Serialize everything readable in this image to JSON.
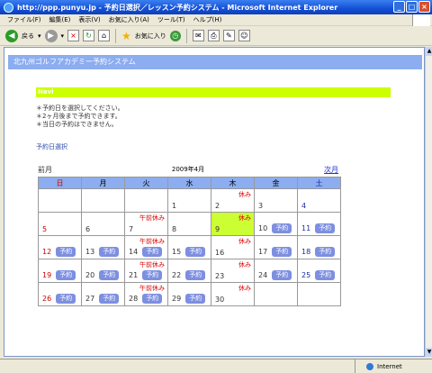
{
  "window": {
    "title": "http://ppp.punyu.jp - 予約日選択／レッスン予約システム - Microsoft Internet Explorer"
  },
  "menu": {
    "items": [
      "ファイル(F)",
      "編集(E)",
      "表示(V)",
      "お気に入り(A)",
      "ツール(T)",
      "ヘルプ(H)"
    ]
  },
  "toolbar": {
    "back_label": "戻る",
    "favorites_label": "お気に入り"
  },
  "status": {
    "zone_label": "Internet"
  },
  "page": {
    "header": "北九州ゴルフアカデミー予約システム",
    "navi": "Navi",
    "notes": [
      "＊予約日を選択してください。",
      "＊2ヶ月後まで予約できます。",
      "＊当日の予約はできません。"
    ],
    "section_link": "予約日選択"
  },
  "calendar": {
    "prev_label": "前月",
    "month_label": "2009年4月",
    "next_label": "次月",
    "reserve_label": "予約",
    "weekdays": [
      "日",
      "月",
      "火",
      "水",
      "木",
      "金",
      "土"
    ],
    "weeks": [
      [
        {
          "day": "",
          "note": "",
          "reserve": false
        },
        {
          "day": "",
          "note": "",
          "reserve": false
        },
        {
          "day": "",
          "note": "",
          "reserve": false
        },
        {
          "day": "1",
          "note": "",
          "reserve": false
        },
        {
          "day": "2",
          "note": "休み",
          "reserve": false
        },
        {
          "day": "3",
          "note": "",
          "reserve": false
        },
        {
          "day": "4",
          "note": "",
          "reserve": false
        }
      ],
      [
        {
          "day": "5",
          "note": "",
          "reserve": false
        },
        {
          "day": "6",
          "note": "",
          "reserve": false
        },
        {
          "day": "7",
          "note": "午前休み",
          "reserve": false
        },
        {
          "day": "8",
          "note": "",
          "reserve": false
        },
        {
          "day": "9",
          "note": "休み",
          "reserve": false,
          "today": true
        },
        {
          "day": "10",
          "note": "",
          "reserve": true
        },
        {
          "day": "11",
          "note": "",
          "reserve": true
        }
      ],
      [
        {
          "day": "12",
          "note": "",
          "reserve": true
        },
        {
          "day": "13",
          "note": "",
          "reserve": true
        },
        {
          "day": "14",
          "note": "午前休み",
          "reserve": true
        },
        {
          "day": "15",
          "note": "",
          "reserve": true
        },
        {
          "day": "16",
          "note": "休み",
          "reserve": false
        },
        {
          "day": "17",
          "note": "",
          "reserve": true
        },
        {
          "day": "18",
          "note": "",
          "reserve": true
        }
      ],
      [
        {
          "day": "19",
          "note": "",
          "reserve": true
        },
        {
          "day": "20",
          "note": "",
          "reserve": true
        },
        {
          "day": "21",
          "note": "午前休み",
          "reserve": true
        },
        {
          "day": "22",
          "note": "",
          "reserve": true
        },
        {
          "day": "23",
          "note": "休み",
          "reserve": false
        },
        {
          "day": "24",
          "note": "",
          "reserve": true
        },
        {
          "day": "25",
          "note": "",
          "reserve": true
        }
      ],
      [
        {
          "day": "26",
          "note": "",
          "reserve": true
        },
        {
          "day": "27",
          "note": "",
          "reserve": true
        },
        {
          "day": "28",
          "note": "午前休み",
          "reserve": true
        },
        {
          "day": "29",
          "note": "",
          "reserve": true
        },
        {
          "day": "30",
          "note": "休み",
          "reserve": false
        },
        {
          "day": "",
          "note": "",
          "reserve": false
        },
        {
          "day": "",
          "note": "",
          "reserve": false
        }
      ]
    ]
  },
  "colors": {
    "header_bg": "#8cadf0",
    "navi_bg": "#ccff00",
    "today_bg": "#ccff33",
    "reserve_btn": "#7d8fe0",
    "holiday_text": "#dd0000"
  }
}
